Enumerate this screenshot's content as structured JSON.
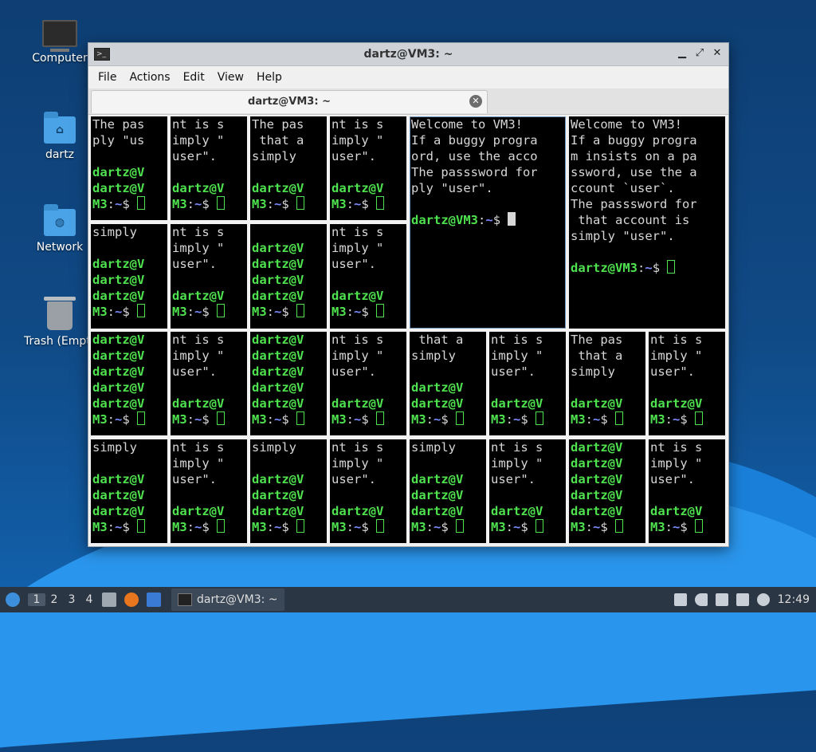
{
  "desktop": {
    "icons": [
      {
        "label": "Computer",
        "icon": "computer-icon"
      },
      {
        "label": "dartz",
        "icon": "home-folder-icon"
      },
      {
        "label": "Network",
        "icon": "network-folder-icon"
      },
      {
        "label": "Trash (Empty)",
        "icon": "trash-icon"
      }
    ]
  },
  "window": {
    "title": "dartz@VM3: ~",
    "menu": [
      "File",
      "Actions",
      "Edit",
      "View",
      "Help"
    ],
    "tab_label": "dartz@VM3: ~"
  },
  "colors": {
    "prompt_user": "#4fe24f",
    "prompt_path": "#7c8cff",
    "terminal_bg": "#000000"
  },
  "panes": {
    "p1": [
      "The pas",
      "ply \"us",
      "",
      "dartz@V",
      "dartz@V",
      "M3:~$ "
    ],
    "p2": [
      "nt is s",
      "imply \"",
      "user\".",
      "",
      "dartz@V",
      "M3:~$ "
    ],
    "p3": [
      "The pas",
      " that a",
      "simply",
      "",
      "dartz@V",
      "M3:~$ "
    ],
    "p4": [
      "nt is s",
      "imply \"",
      "user\".",
      "",
      "dartz@V",
      "M3:~$ "
    ],
    "p5": [
      "Welcome to VM3!",
      "If a buggy progra",
      "ord, use the acco",
      "The passsword for",
      "ply \"user\".",
      "",
      "dartz@VM3:~$ "
    ],
    "p6": [
      "Welcome to VM3!",
      "If a buggy progra",
      "m insists on a pa",
      "ssword, use the a",
      "ccount `user`.",
      "The passsword for",
      " that account is",
      "simply \"user\".",
      "",
      "dartz@VM3:~$ "
    ],
    "p7": [
      "simply",
      "",
      "dartz@V",
      "dartz@V",
      "dartz@V",
      "M3:~$ "
    ],
    "p8": [
      "nt is s",
      "imply \"",
      "user\".",
      "",
      "dartz@V",
      "M3:~$ "
    ],
    "p9": [
      "",
      "dartz@V",
      "dartz@V",
      "dartz@V",
      "dartz@V",
      "M3:~$ "
    ],
    "p10": [
      "nt is s",
      "imply \"",
      "user\".",
      "",
      "dartz@V",
      "M3:~$ "
    ],
    "p11": [
      "dartz@V",
      "dartz@V",
      "dartz@V",
      "dartz@V",
      "dartz@V",
      "M3:~$ "
    ],
    "p12": [
      "nt is s",
      "imply \"",
      "user\".",
      "",
      "dartz@V",
      "M3:~$ "
    ],
    "p13": [
      "dartz@V",
      "dartz@V",
      "dartz@V",
      "dartz@V",
      "dartz@V",
      "M3:~$ "
    ],
    "p14": [
      "nt is s",
      "imply \"",
      "user\".",
      "",
      "dartz@V",
      "M3:~$ "
    ],
    "p15": [
      " that a",
      "simply",
      "",
      "dartz@V",
      "dartz@V",
      "M3:~$ "
    ],
    "p16": [
      "nt is s",
      "imply \"",
      "user\".",
      "",
      "dartz@V",
      "M3:~$ "
    ],
    "p17": [
      "The pas",
      " that a",
      "simply",
      "",
      "dartz@V",
      "M3:~$ "
    ],
    "p18": [
      "nt is s",
      "imply \"",
      "user\".",
      "",
      "dartz@V",
      "M3:~$ "
    ],
    "p19": [
      "simply",
      "",
      "dartz@V",
      "dartz@V",
      "dartz@V",
      "M3:~$ "
    ],
    "p20": [
      "nt is s",
      "imply \"",
      "user\".",
      "",
      "dartz@V",
      "M3:~$ "
    ],
    "p21": [
      "simply",
      "",
      "dartz@V",
      "dartz@V",
      "dartz@V",
      "M3:~$ "
    ],
    "p22": [
      "nt is s",
      "imply \"",
      "user\".",
      "",
      "dartz@V",
      "M3:~$ "
    ],
    "p23": [
      "simply",
      "",
      "dartz@V",
      "dartz@V",
      "dartz@V",
      "M3:~$ "
    ],
    "p24": [
      "nt is s",
      "imply \"",
      "user\".",
      "",
      "dartz@V",
      "M3:~$ "
    ],
    "p25": [
      "dartz@V",
      "dartz@V",
      "dartz@V",
      "dartz@V",
      "dartz@V",
      "M3:~$ "
    ],
    "p26": [
      "nt is s",
      "imply \"",
      "user\".",
      "",
      "dartz@V",
      "M3:~$ "
    ]
  },
  "taskbar": {
    "workspaces": [
      "1",
      "2",
      "3",
      "4"
    ],
    "task_label": "dartz@VM3: ~",
    "clock": "12:49"
  }
}
